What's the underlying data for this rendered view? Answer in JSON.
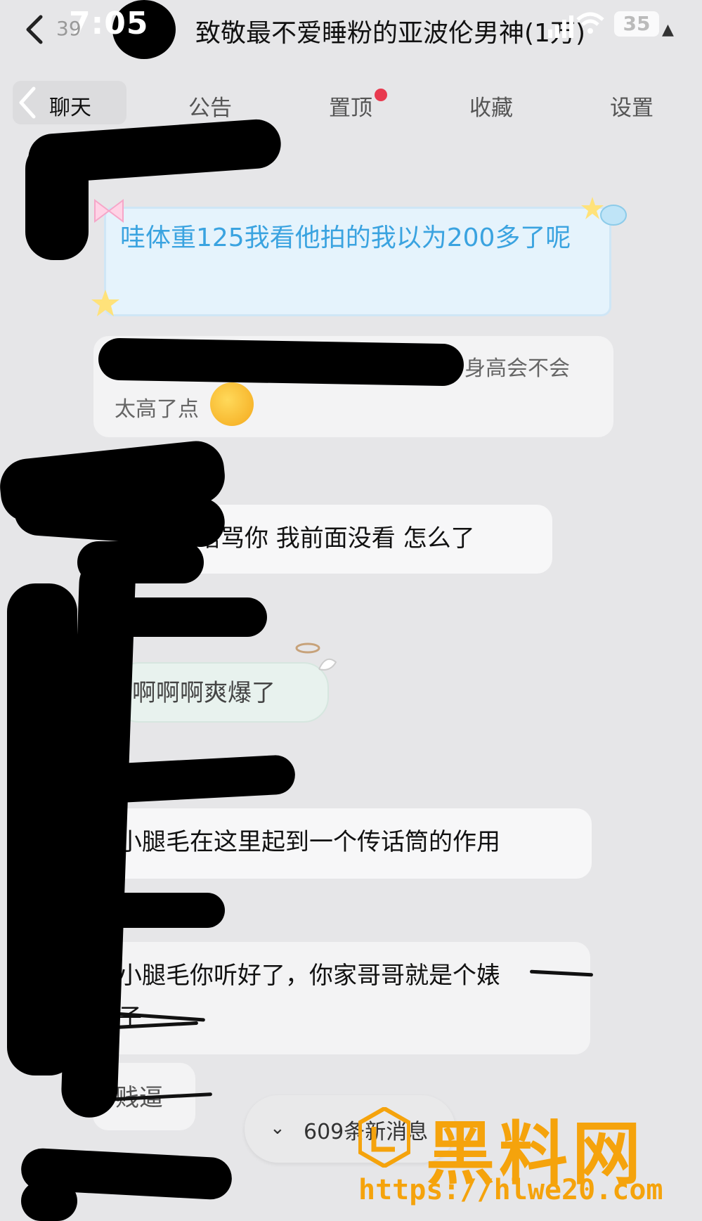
{
  "status": {
    "time": "7:05",
    "unread": "39",
    "battery": "35"
  },
  "header": {
    "title": "致敬最不爱睡粉的亚波伦男神(1万)"
  },
  "tabs": {
    "chat": "聊天",
    "notice": "公告",
    "pin": "置顶",
    "favorites": "收藏",
    "settings": "设置"
  },
  "messages": {
    "m1": "哇体重125我看他拍的我以为200多了呢",
    "m2_part1": "身高会不会",
    "m2_part2": "太高了点",
    "m3": "啥骂你 我前面没看 怎么了",
    "m4": "啊啊啊爽爆了",
    "m5": "小腿毛在这里起到一个传话筒的作用",
    "m6_line1": "小腿毛你听好了，你家哥哥就是个婊",
    "m6_line2": "子",
    "m7": "贱逼"
  },
  "new_messages": {
    "label": "609条新消息"
  },
  "watermark": {
    "brand": "黑料网",
    "url": "https://hlwe20.com"
  },
  "colors": {
    "accent_blue": "#3aa3e0",
    "badge_red": "#e83a4f",
    "watermark_orange": "#f5a30c"
  }
}
